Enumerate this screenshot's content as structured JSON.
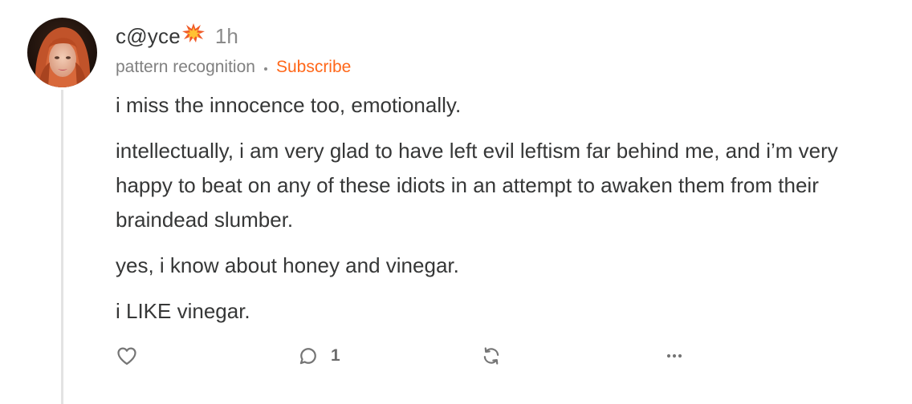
{
  "comment": {
    "author": "c@yce",
    "author_emoji_icon": "collision-icon",
    "timestamp": "1h",
    "publication": "pattern recognition",
    "subscribe_label": "Subscribe",
    "paragraphs": [
      "i miss the innocence too, emotionally.",
      "intellectually, i am very glad to have left evil leftism far behind me, and i’m very happy to beat on any of these idiots in an attempt to awaken them from their braindead slumber.",
      "yes, i know about honey and vinegar.",
      "i LIKE vinegar."
    ],
    "actions": {
      "like_icon": "heart-icon",
      "reply_icon": "comment-icon",
      "reply_count": "1",
      "restack_icon": "restack-icon",
      "more_icon": "more-icon"
    }
  },
  "colors": {
    "accent": "#ff6719",
    "text": "#363737",
    "muted": "#808080",
    "thread_line": "#e3e3e3"
  }
}
